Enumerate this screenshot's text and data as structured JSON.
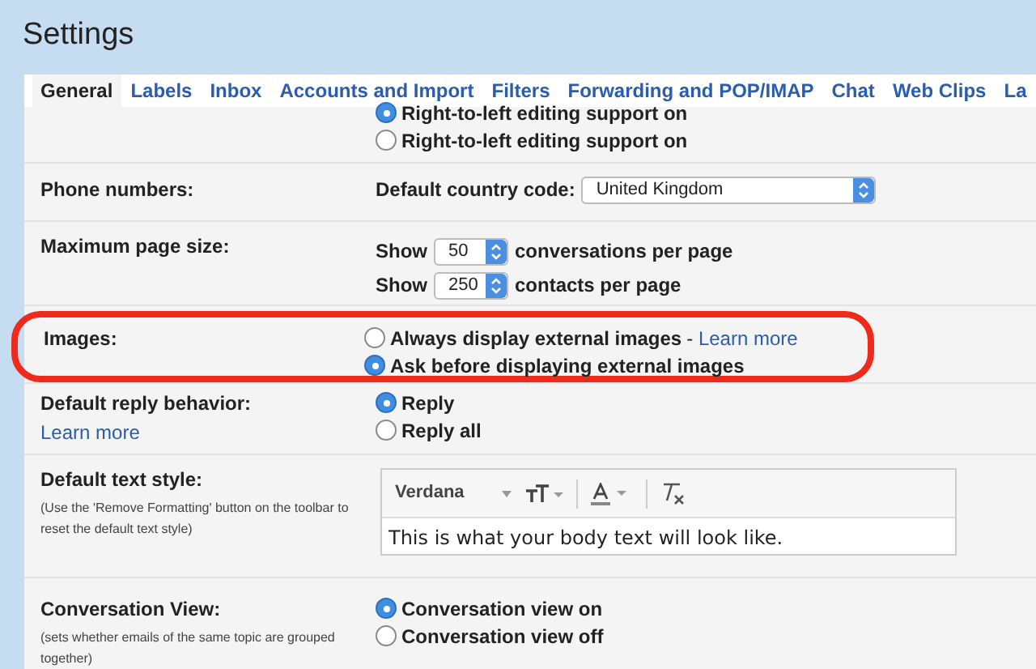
{
  "window": {
    "title": "Settings"
  },
  "tabs": [
    {
      "label": "General",
      "selected": true
    },
    {
      "label": "Labels",
      "selected": false
    },
    {
      "label": "Inbox",
      "selected": false
    },
    {
      "label": "Accounts and Import",
      "selected": false
    },
    {
      "label": "Filters",
      "selected": false
    },
    {
      "label": "Forwarding and POP/IMAP",
      "selected": false
    },
    {
      "label": "Chat",
      "selected": false
    },
    {
      "label": "Web Clips",
      "selected": false
    },
    {
      "label": "La",
      "selected": false
    }
  ],
  "rtl_options": [
    {
      "label": "Right-to-left editing support on",
      "selected": true
    },
    {
      "label": "Right-to-left editing support on",
      "selected": false
    }
  ],
  "phone_numbers": {
    "label": "Phone numbers:",
    "field_label": "Default country code:",
    "value": "United Kingdom"
  },
  "page_size": {
    "label": "Maximum page size:",
    "rows": [
      {
        "prefix": "Show",
        "value": "50",
        "suffix": "conversations per page"
      },
      {
        "prefix": "Show",
        "value": "250",
        "suffix": "contacts per page"
      }
    ]
  },
  "images": {
    "label": "Images:",
    "highlighted": true,
    "options": [
      {
        "label": "Always display external images",
        "separator": "-",
        "link": "Learn more",
        "selected": false
      },
      {
        "label": "Ask before displaying external images",
        "selected": true
      }
    ]
  },
  "reply": {
    "label": "Default reply behavior:",
    "link": "Learn more",
    "options": [
      {
        "label": "Reply",
        "selected": true
      },
      {
        "label": "Reply all",
        "selected": false
      }
    ]
  },
  "text_style": {
    "label": "Default text style:",
    "note": "(Use the 'Remove Formatting' button on the toolbar to reset the default text style)",
    "font": "Verdana",
    "sample": "This is what your body text will look like."
  },
  "conversation_view": {
    "label": "Conversation View:",
    "note": "(sets whether emails of the same topic are grouped together)",
    "options": [
      {
        "label": "Conversation view on",
        "selected": true
      },
      {
        "label": "Conversation view off",
        "selected": false
      }
    ]
  }
}
